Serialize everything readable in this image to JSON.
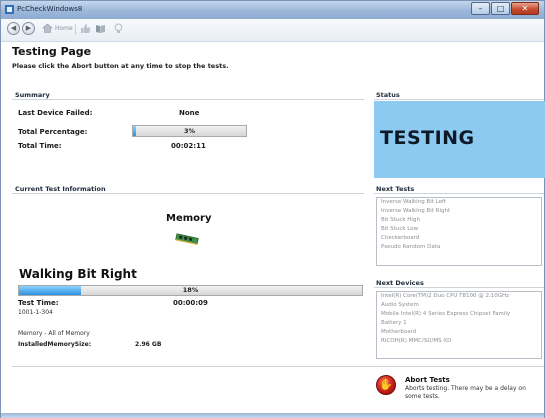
{
  "window": {
    "title": "PcCheckWindows8",
    "controls": {
      "minimize_icon": "minimize-icon",
      "maximize_icon": "maximize-icon",
      "close_icon": "close-icon"
    }
  },
  "toolbar": {
    "home_label": "Home",
    "icons": [
      "back-arrow-icon",
      "forward-arrow-icon",
      "home-icon",
      "thumbs-up-icon",
      "book-icon",
      "lightbulb-icon"
    ]
  },
  "page": {
    "title": "Testing Page",
    "subtitle": "Please click the Abort button at any time to stop the tests."
  },
  "summary": {
    "heading": "Summary",
    "last_device_failed_label": "Last Device Failed:",
    "last_device_failed_value": "None",
    "total_percentage_label": "Total Percentage:",
    "total_percentage_text": "3%",
    "total_percentage_value": 3,
    "total_time_label": "Total Time:",
    "total_time_value": "00:02:11"
  },
  "status": {
    "heading": "Status",
    "value": "TESTING",
    "color": "#8ccaf2"
  },
  "current_test": {
    "heading": "Current Test Information",
    "device": "Memory",
    "device_icon": "memory-module-icon",
    "test_name": "Walking Bit Right",
    "progress_text": "18%",
    "progress_value": 18,
    "test_time_label": "Test Time:",
    "test_time_value": "00:00:09",
    "test_code": "1001-1-304",
    "memory_scope": "Memory - All of Memory",
    "installed_memory_label": "InstalledMemorySize:",
    "installed_memory_value": "2.96 GB"
  },
  "next_tests": {
    "heading": "Next Tests",
    "items": [
      "Inverse Walking Bit Left",
      "Inverse Walking Bit Right",
      "Bit Stuck High",
      "Bit Stuck Low",
      "Checkerboard",
      "Pseudo Random Data"
    ]
  },
  "next_devices": {
    "heading": "Next Devices",
    "items": [
      "Intel(R) Core(TM)2 Duo CPU     T8100  @ 2.10GHz",
      "Audio System",
      "Mobile Intel(R) 4 Series Express Chipset Family",
      "Battery 1",
      "Motherboard",
      "RICOH(R) MMC/SD/MS XD"
    ]
  },
  "abort": {
    "title": "Abort Tests",
    "description": "Aborts testing. There may be a delay on some tests.",
    "icon": "abort-stop-icon",
    "color": "#c01a10"
  },
  "colors": {
    "progress_fill": "#2d8fe0",
    "titlebar": "#9db7da"
  }
}
